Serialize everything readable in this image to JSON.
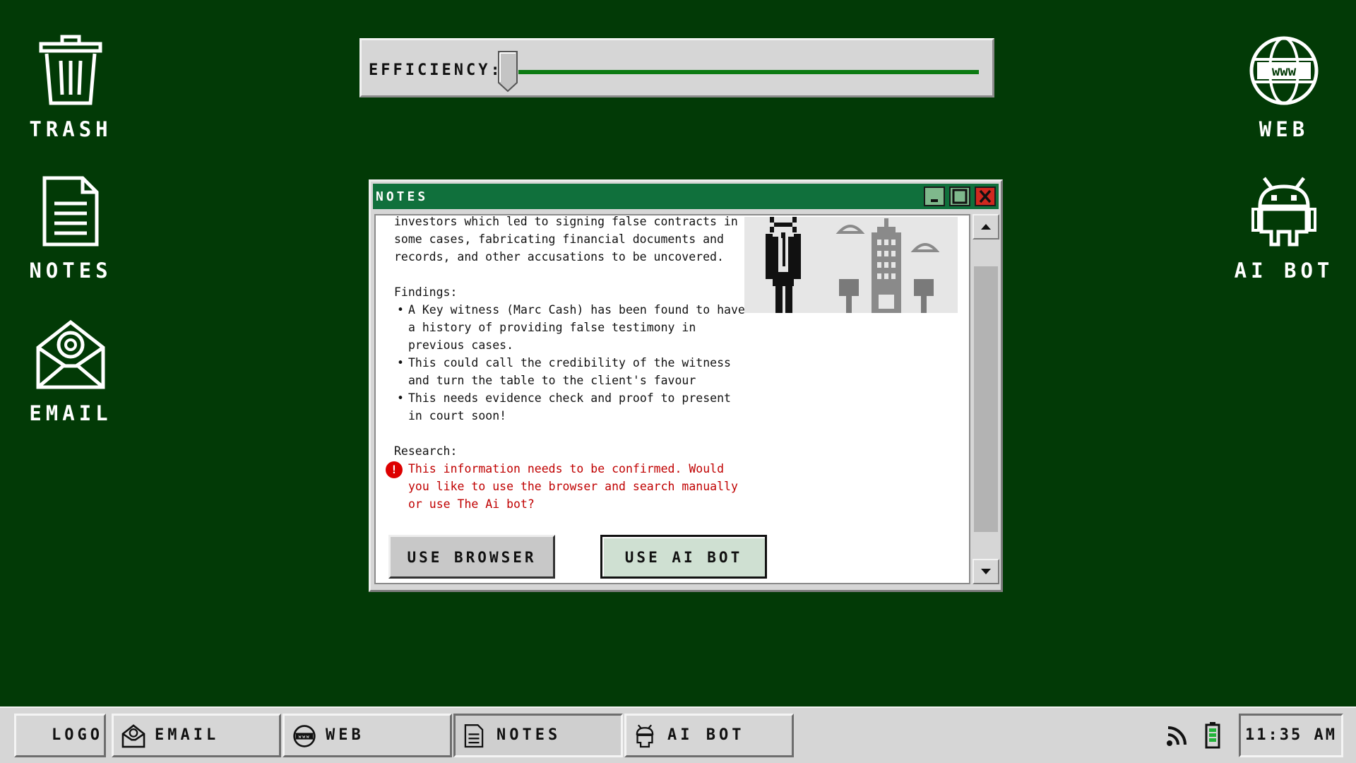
{
  "desktop": {
    "left_icons": [
      {
        "label": "TRASH",
        "icon": "trash-icon"
      },
      {
        "label": "NOTES",
        "icon": "notes-icon"
      },
      {
        "label": "EMAIL",
        "icon": "email-icon"
      }
    ],
    "right_icons": [
      {
        "label": "WEB",
        "icon": "globe-www-icon"
      },
      {
        "label": "AI BOT",
        "icon": "android-robot-icon"
      }
    ]
  },
  "efficiency": {
    "label": "EFFICIENCY:",
    "level_percent": 3
  },
  "window": {
    "title": "NOTES",
    "intro_lines": [
      "investors which led to signing false contracts in",
      "some cases, fabricating financial documents and",
      "records, and other accusations to be uncovered."
    ],
    "findings_heading": "Findings:",
    "findings": [
      "A Key witness (Marc Cash) has been found to have a history of providing false testimony in previous cases.",
      "This could call the credibility of the witness and turn the table to the client's favour",
      "This needs evidence check and proof to present in court soon!"
    ],
    "research_heading": "Research:",
    "alert_text": "This information needs to be confirmed. Would you like to use the browser and search manually or use The Ai bot?",
    "alert_icon": "exclamation-icon",
    "buttons": {
      "browser": "USE BROWSER",
      "ai": "USE AI BOT"
    },
    "picture": "pixel-art businessman with city skyline"
  },
  "taskbar": {
    "items": [
      {
        "label": "LOGO",
        "icon": ""
      },
      {
        "label": "EMAIL",
        "icon": "email-icon"
      },
      {
        "label": "WEB",
        "icon": "globe-www-icon"
      },
      {
        "label": "NOTES",
        "icon": "notes-icon",
        "active": true
      },
      {
        "label": "AI BOT",
        "icon": "android-robot-icon"
      }
    ],
    "tray": {
      "wifi": "wifi-icon",
      "battery": "battery-icon"
    },
    "clock": "11:35 AM"
  },
  "colors": {
    "desktop_bg": "#023a06",
    "titlebar": "#10703c",
    "accent_green": "#0c7a12",
    "alert_red": "#c00000"
  }
}
